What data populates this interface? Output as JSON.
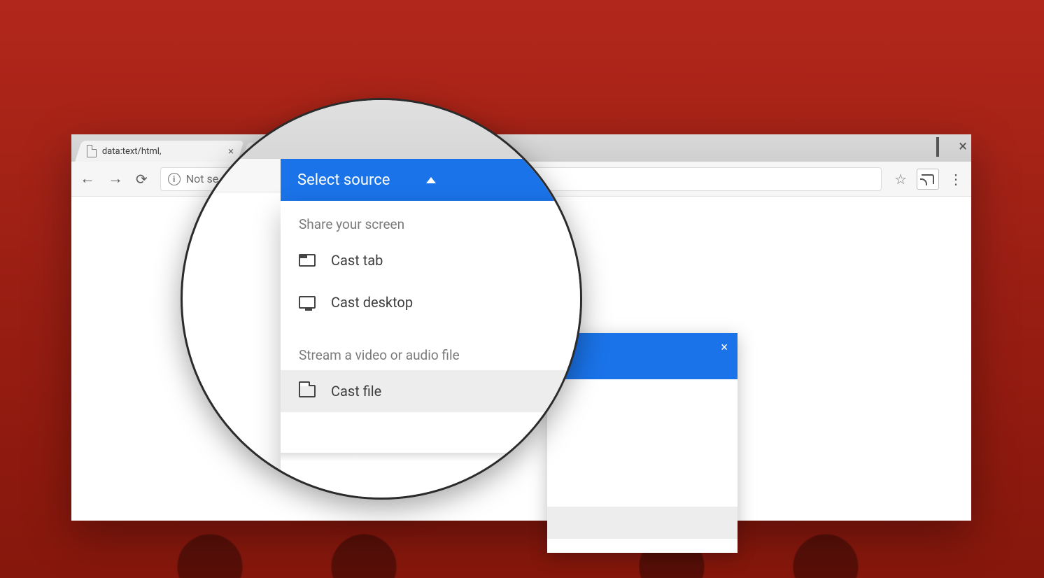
{
  "browser": {
    "tab_title": "data:text/html,",
    "address_prefix_label": "Not se",
    "nav": {
      "back": "←",
      "forward": "→"
    }
  },
  "cast_dialog": {
    "header_title": "Select source",
    "section_share": "Share your screen",
    "item_tab": "Cast tab",
    "item_desktop": "Cast desktop",
    "section_stream": "Stream a video or audio file",
    "item_file": "Cast file",
    "close": "×"
  }
}
